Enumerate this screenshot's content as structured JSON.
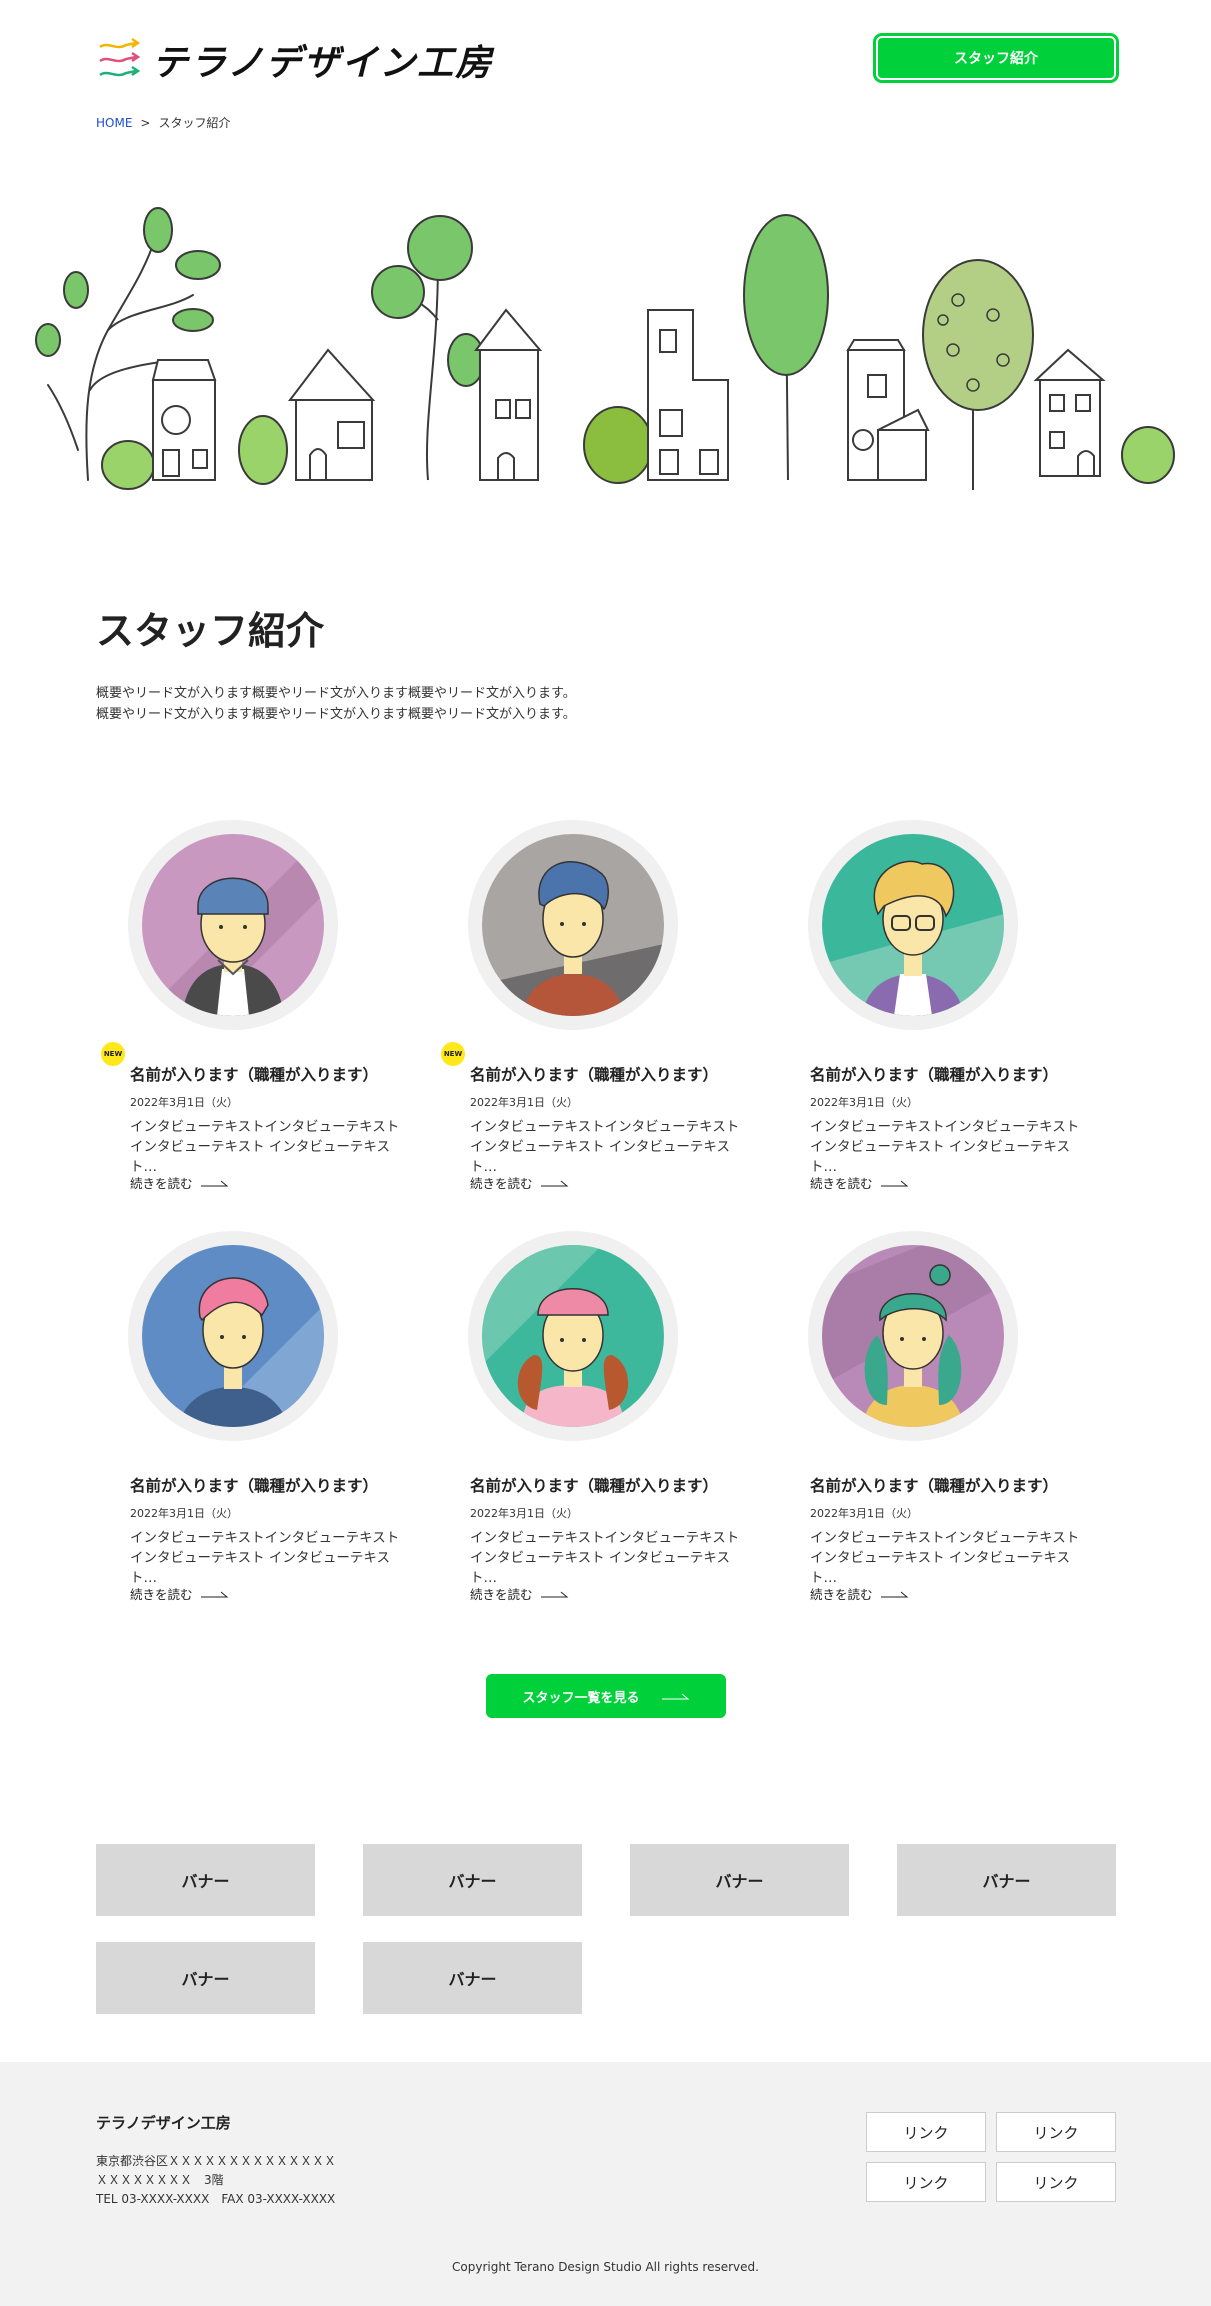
{
  "header": {
    "logo_text": "テラノデザイン工房",
    "cta_label": "スタッフ紹介"
  },
  "breadcrumb": {
    "home": "HOME",
    "separator": ">",
    "current": "スタッフ紹介"
  },
  "intro": {
    "title": "スタッフ紹介",
    "lead_line1": "概要やリード文が入ります概要やリード文が入ります概要やリード文が入ります。",
    "lead_line2": "概要やリード文が入ります概要やリード文が入ります概要やリード文が入ります。"
  },
  "staff": [
    {
      "new": true,
      "badge": "NEW",
      "name": "名前が入ります（職種が入ります）",
      "date": "2022年3月1日（火）",
      "text": "インタビューテキストインタビューテキストインタビューテキスト インタビューテキスト…",
      "more": "続きを読む",
      "bg": "#c898c0",
      "hair": "#5a83b8",
      "avatar": "beanie"
    },
    {
      "new": true,
      "badge": "NEW",
      "name": "名前が入ります（職種が入ります）",
      "date": "2022年3月1日（火）",
      "text": "インタビューテキストインタビューテキストインタビューテキスト インタビューテキスト…",
      "more": "続きを読む",
      "bg": "#a9a5a3",
      "hair": "#4b74ad",
      "avatar": "quiff"
    },
    {
      "new": false,
      "badge": "",
      "name": "名前が入ります（職種が入ります）",
      "date": "2022年3月1日（火）",
      "text": "インタビューテキストインタビューテキストインタビューテキスト インタビューテキスト…",
      "more": "続きを読む",
      "bg": "#3bb89c",
      "hair": "#f0c860",
      "avatar": "glasses"
    },
    {
      "new": false,
      "badge": "",
      "name": "名前が入ります（職種が入ります）",
      "date": "2022年3月1日（火）",
      "text": "インタビューテキストインタビューテキストインタビューテキスト インタビューテキスト…",
      "more": "続きを読む",
      "bg": "#5f8cc4",
      "hair": "#f07ca0",
      "avatar": "pink-hair"
    },
    {
      "new": false,
      "badge": "",
      "name": "名前が入ります（職種が入ります）",
      "date": "2022年3月1日（火）",
      "text": "インタビューテキストインタビューテキストインタビューテキスト インタビューテキスト…",
      "more": "続きを読む",
      "bg": "#3db89c",
      "hair": "#b8582e",
      "avatar": "curly"
    },
    {
      "new": false,
      "badge": "",
      "name": "名前が入ります（職種が入ります）",
      "date": "2022年3月1日（火）",
      "text": "インタビューテキストインタビューテキストインタビューテキスト インタビューテキスト…",
      "more": "続きを読む",
      "bg": "#b98ab8",
      "hair": "#3aa88c",
      "avatar": "bun"
    }
  ],
  "all_staff_label": "スタッフ一覧を見る",
  "banners": [
    "バナー",
    "バナー",
    "バナー",
    "バナー",
    "バナー",
    "バナー"
  ],
  "footer": {
    "company": "テラノデザイン工房",
    "address_line1": "東京都渋谷区ＸＸＸＸＸＸＸＸＸＸＸＸＸＸ",
    "address_line2": "ＸＸＸＸＸＸＸＸ　3階",
    "tel_fax": "TEL 03-XXXX-XXXX　FAX 03-XXXX-XXXX",
    "links": [
      "リンク",
      "リンク",
      "リンク",
      "リンク"
    ],
    "copyright": "Copyright Terano Design Studio All rights reserved."
  },
  "colors": {
    "accent": "#00d13a",
    "breadcrumb_link": "#1a4fd6",
    "badge": "#ffe81a",
    "banner_bg": "#d8d8d8",
    "footer_bg": "#f2f2f2"
  }
}
